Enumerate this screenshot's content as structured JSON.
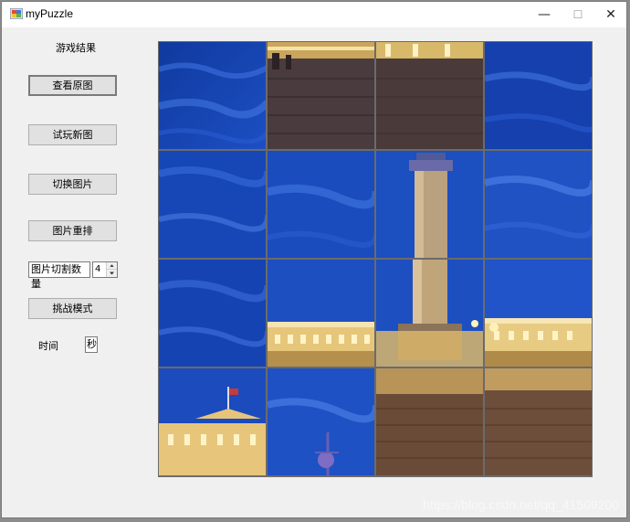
{
  "window": {
    "title": "myPuzzle",
    "controls": {
      "minimize": "—",
      "maximize": "☐",
      "close": "✕"
    }
  },
  "sidebar": {
    "result_label": "游戏结果",
    "view_original_button": "查看原图",
    "try_new_button": "试玩新图",
    "switch_image_button": "切换图片",
    "reshuffle_button": "图片重排",
    "split_count_label": "图片切割数量",
    "split_count_value": "4",
    "challenge_button": "挑战模式",
    "time_label": "时间",
    "time_value": "秒"
  },
  "puzzle": {
    "grid_size": 4,
    "tiles": [
      {
        "row": 0,
        "col": 0,
        "content": "sky"
      },
      {
        "row": 0,
        "col": 1,
        "content": "plaza-building-top"
      },
      {
        "row": 0,
        "col": 2,
        "content": "plaza-building-top"
      },
      {
        "row": 0,
        "col": 3,
        "content": "sky"
      },
      {
        "row": 1,
        "col": 0,
        "content": "sky"
      },
      {
        "row": 1,
        "col": 1,
        "content": "sky"
      },
      {
        "row": 1,
        "col": 2,
        "content": "column-top"
      },
      {
        "row": 1,
        "col": 3,
        "content": "sky"
      },
      {
        "row": 2,
        "col": 0,
        "content": "sky"
      },
      {
        "row": 2,
        "col": 1,
        "content": "palace-left"
      },
      {
        "row": 2,
        "col": 2,
        "content": "column-base"
      },
      {
        "row": 2,
        "col": 3,
        "content": "palace-right"
      },
      {
        "row": 3,
        "col": 0,
        "content": "palace-flag"
      },
      {
        "row": 3,
        "col": 1,
        "content": "statue"
      },
      {
        "row": 3,
        "col": 2,
        "content": "cobblestones"
      },
      {
        "row": 3,
        "col": 3,
        "content": "cobblestones"
      }
    ],
    "watermark": "https://blog.csdn.net/qq_41509200"
  },
  "colors": {
    "sky_dark": "#0d2f9a",
    "sky_light": "#2d63d9",
    "gold": "#e7b85a"
  }
}
